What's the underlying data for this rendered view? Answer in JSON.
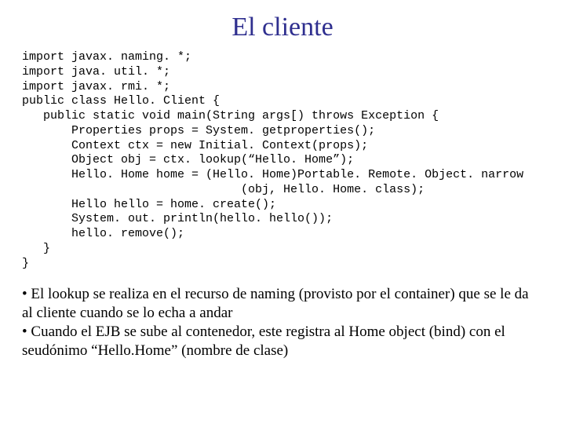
{
  "title": "El cliente",
  "code": "import javax. naming. *;\nimport java. util. *;\nimport javax. rmi. *;\npublic class Hello. Client {\n   public static void main(String args[) throws Exception {\n       Properties props = System. getproperties();\n       Context ctx = new Initial. Context(props);\n       Object obj = ctx. lookup(“Hello. Home”);\n       Hello. Home home = (Hello. Home)Portable. Remote. Object. narrow\n                               (obj, Hello. Home. class);\n       Hello hello = home. create();\n       System. out. println(hello. hello());\n       hello. remove();\n   }\n}",
  "bullets": [
    "• El lookup se realiza en el recurso de naming (provisto por el container) que se le da al cliente cuando se lo echa a andar",
    "• Cuando el EJB se sube al contenedor, este registra al Home object (bind) con el seudónimo “Hello.Home” (nombre de clase)"
  ]
}
